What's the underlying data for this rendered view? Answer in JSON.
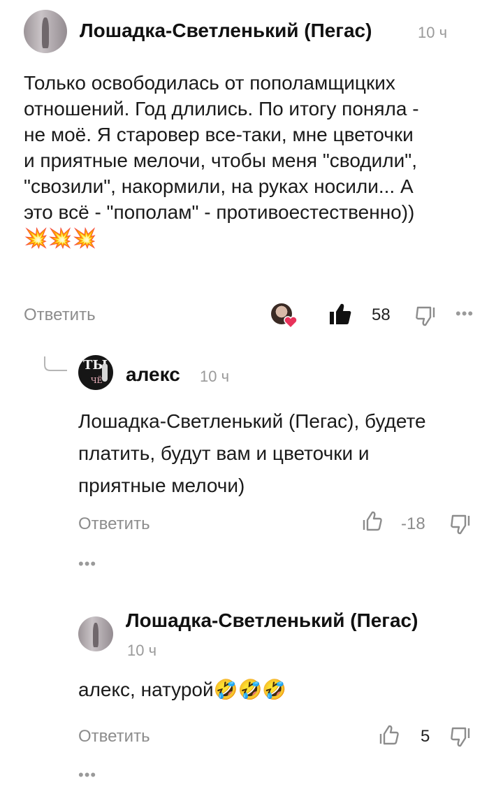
{
  "comments": [
    {
      "author": "Лошадка-Светленький (Пегас)",
      "time": "10 ч",
      "text_lines": [
        "Только освободилась от пополамщицких",
        "отношений. Год длились. По итогу поняла -",
        "не моё. Я старовер все-таки, мне цветочки",
        "и приятные мелочи, чтобы меня \"сводили\",",
        "\"свозили\", накормили, на руках носили... А",
        "это всё - \"пополам\" - противоестественно))"
      ],
      "emoji": "💥💥💥",
      "reply_label": "Ответить",
      "likes": "58"
    }
  ],
  "replies": [
    {
      "author": "алекс",
      "time": "10 ч",
      "avatar_text": "ТЫ",
      "avatar_small": "ЧЁ",
      "text_lines": [
        "Лошадка-Светленький (Пегас), будете",
        "платить, будут вам и цветочки и",
        "приятные мелочи)"
      ],
      "reply_label": "Ответить",
      "likes": "-18"
    },
    {
      "author": "Лошадка-Светленький (Пегас)",
      "time": "10 ч",
      "text": "алекс, натурой",
      "emoji": "🤣🤣🤣",
      "reply_label": "Ответить",
      "likes": "5"
    }
  ],
  "icons": {
    "like_filled": "thumbs-up-filled-icon",
    "like_outline": "thumbs-up-outline-icon",
    "dislike": "thumbs-down-icon",
    "more": "more-dots-icon",
    "thread": "thread-connector-icon"
  },
  "colors": {
    "text": "#1a1a1a",
    "muted": "#8c8c8c",
    "background": "#ffffff"
  }
}
